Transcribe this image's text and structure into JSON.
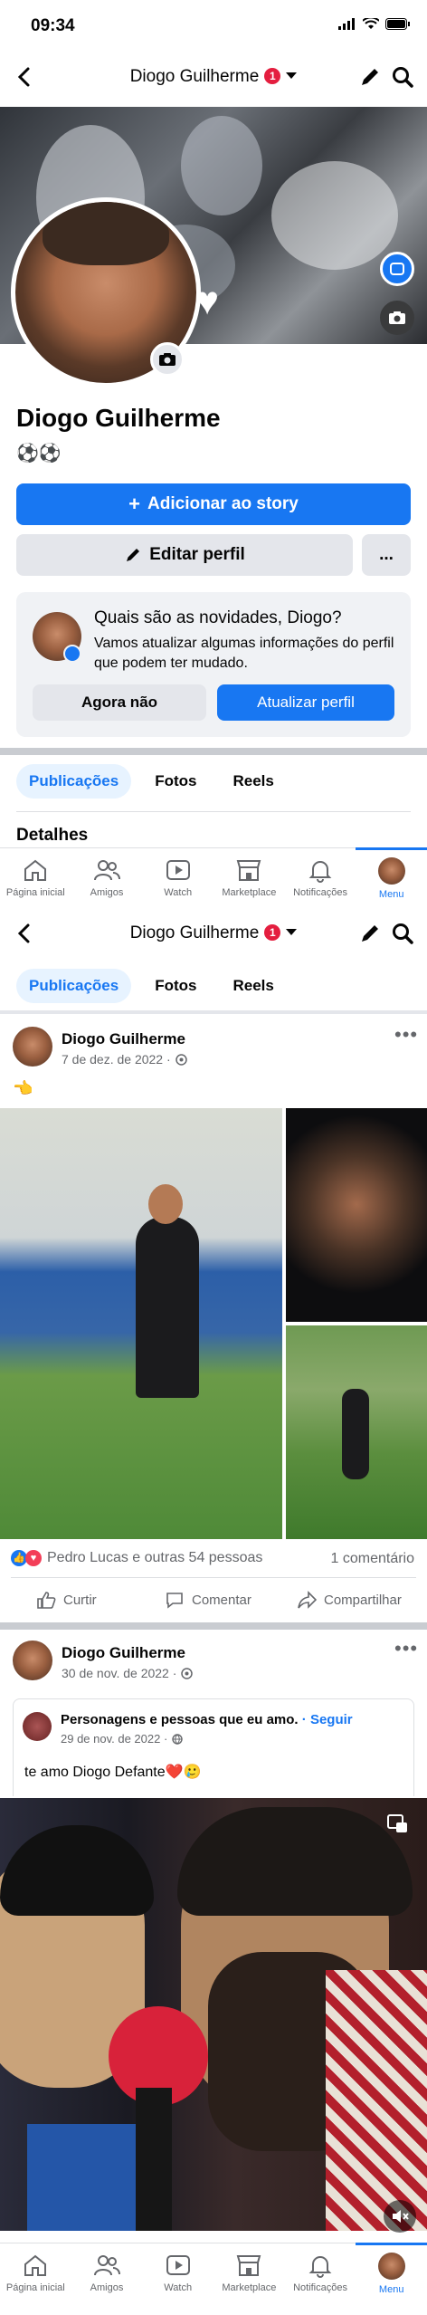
{
  "status_bar": {
    "time": "09:34"
  },
  "header": {
    "title": "Diogo Guilherme",
    "badge": "1"
  },
  "profile": {
    "name": "Diogo Guilherme",
    "emojis": "⚽⚽",
    "add_story": "Adicionar ao story",
    "edit_profile": "Editar perfil",
    "more": "..."
  },
  "update_card": {
    "title": "Quais são as novidades, Diogo?",
    "text": "Vamos atualizar algumas informações do perfil que podem ter mudado.",
    "later": "Agora não",
    "update": "Atualizar perfil"
  },
  "tabs": [
    "Publicações",
    "Fotos",
    "Reels"
  ],
  "details": "Detalhes",
  "nav": [
    "Página inicial",
    "Amigos",
    "Watch",
    "Marketplace",
    "Notificações",
    "Menu"
  ],
  "post1": {
    "author": "Diogo Guilherme",
    "date": "7 de dez. de 2022 ·",
    "text": "👈",
    "reactions": "Pedro Lucas e outras 54 pessoas",
    "comments": "1 comentário",
    "like": "Curtir",
    "comment": "Comentar",
    "share": "Compartilhar"
  },
  "post2": {
    "author": "Diogo Guilherme",
    "date": "30 de nov. de 2022 ·",
    "shared_page": "Personagens e pessoas que eu amo.",
    "follow": "· Seguir",
    "shared_date": "29 de nov. de 2022 ·",
    "shared_text": "te amo Diogo Defante❤️🥲"
  },
  "colors": {
    "accent": "#1877f2",
    "badge": "#e41e3f",
    "grey_button": "#e4e6eb",
    "divider": "#c9ccd1"
  }
}
